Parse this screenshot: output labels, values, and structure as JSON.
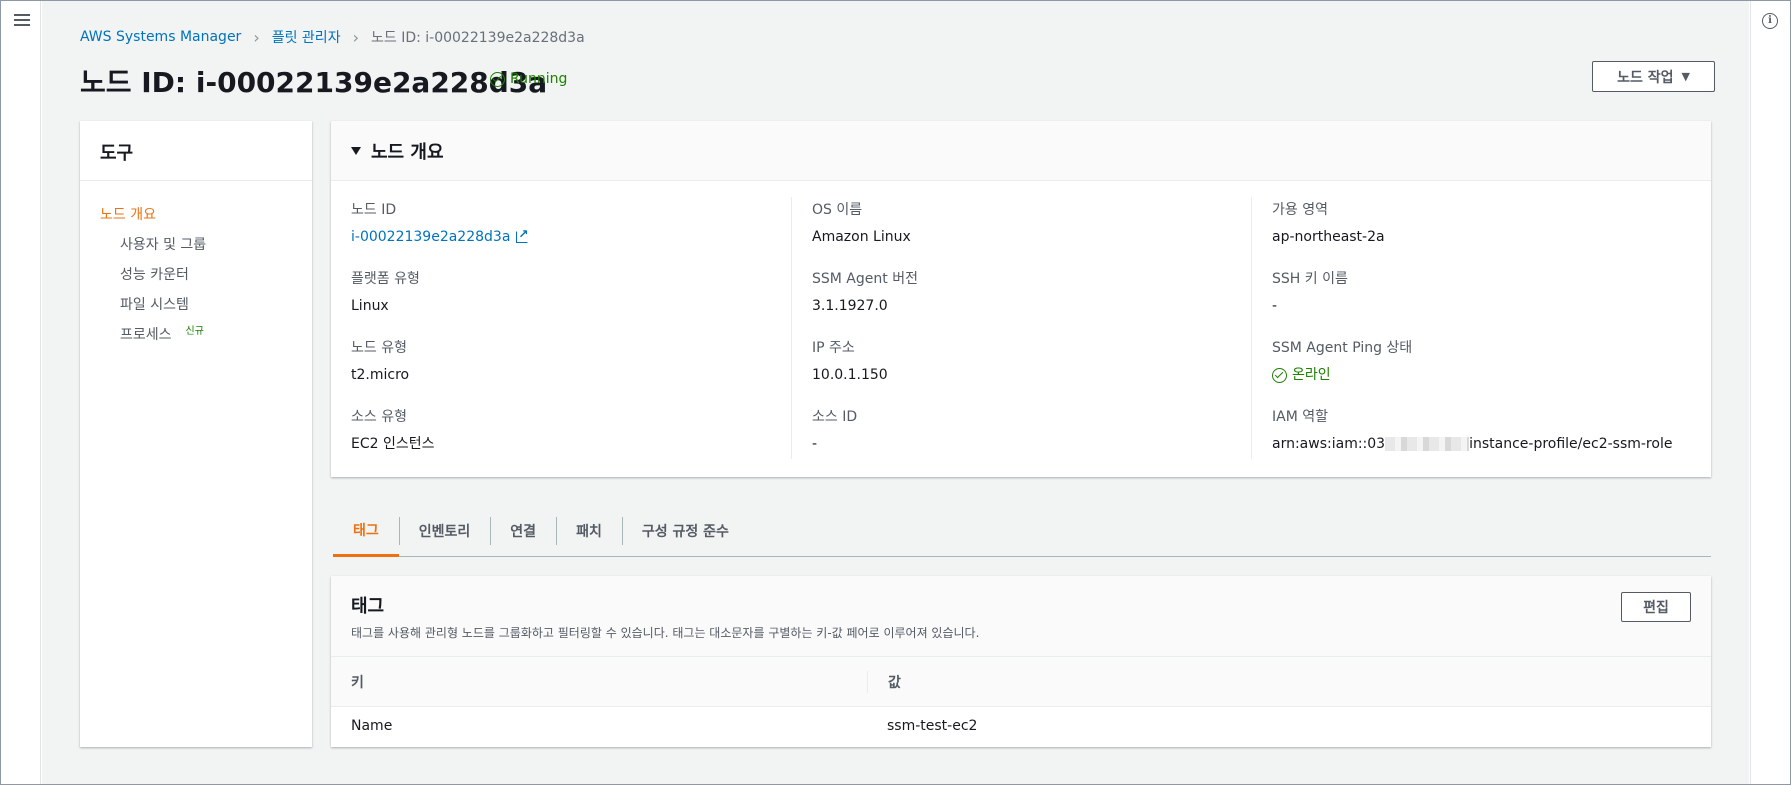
{
  "breadcrumb": {
    "item1": "AWS Systems Manager",
    "item2": "플릿 관리자",
    "current": "노드 ID: i-00022139e2a228d3a"
  },
  "header": {
    "title": "노드 ID: i-00022139e2a228d3a",
    "status": "Running",
    "action_button": "노드 작업"
  },
  "tools": {
    "title": "도구",
    "items": [
      {
        "label": "노드 개요"
      },
      {
        "label": "사용자 및 그룹"
      },
      {
        "label": "성능 카운터"
      },
      {
        "label": "파일 시스템"
      },
      {
        "label": "프로세스",
        "badge": "신규"
      }
    ]
  },
  "overview": {
    "title": "노드 개요",
    "col1": [
      {
        "label": "노드 ID",
        "value": "i-00022139e2a228d3a"
      },
      {
        "label": "플랫폼 유형",
        "value": "Linux"
      },
      {
        "label": "노드 유형",
        "value": "t2.micro"
      },
      {
        "label": "소스 유형",
        "value": "EC2 인스턴스"
      }
    ],
    "col2": [
      {
        "label": "OS 이름",
        "value": "Amazon Linux"
      },
      {
        "label": "SSM Agent 버전",
        "value": "3.1.1927.0"
      },
      {
        "label": "IP 주소",
        "value": "10.0.1.150"
      },
      {
        "label": "소스 ID",
        "value": "-"
      }
    ],
    "col3": [
      {
        "label": "가용 영역",
        "value": "ap-northeast-2a"
      },
      {
        "label": "SSH 키 이름",
        "value": "-"
      },
      {
        "label": "SSM Agent Ping 상태",
        "value": "온라인"
      },
      {
        "label": "IAM 역할",
        "value_prefix": "arn:aws:iam::03",
        "value_suffix": "instance-profile/ec2-ssm-role"
      }
    ]
  },
  "tabs": [
    {
      "label": "태그"
    },
    {
      "label": "인벤토리"
    },
    {
      "label": "연결"
    },
    {
      "label": "패치"
    },
    {
      "label": "구성 규정 준수"
    }
  ],
  "tags": {
    "title": "태그",
    "description": "태그를 사용해 관리형 노드를 그룹화하고 필터링할 수 있습니다. 태그는 대소문자를 구별하는 키-값 페어로 이루어져 있습니다.",
    "edit_button": "편집",
    "columns": {
      "key": "키",
      "value": "값"
    },
    "rows": [
      {
        "key": "Name",
        "value": "ssm-test-ec2"
      }
    ]
  },
  "colors": {
    "accent": "#ec7211",
    "link": "#0073bb",
    "success": "#1d8102"
  },
  "icons": [
    "menu-icon",
    "info-icon",
    "chevron-right-icon",
    "status-check-icon",
    "caret-down-icon",
    "external-link-icon",
    "triangle-down-icon"
  ]
}
